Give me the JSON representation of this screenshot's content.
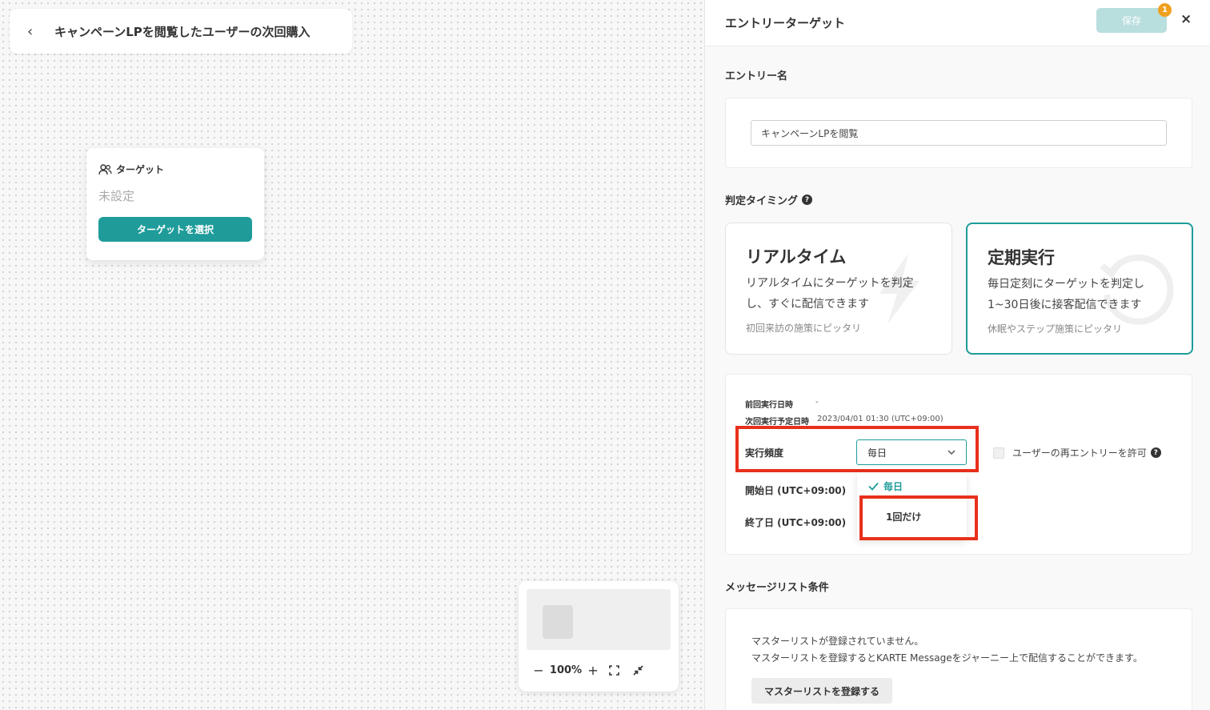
{
  "header": {
    "journey_title": "キャンペーンLPを閲覧したユーザーの次回購入",
    "back_icon": "chevron-left-icon"
  },
  "target_node": {
    "title": "ターゲット",
    "icon": "users-icon",
    "status": "未設定",
    "button_label": "ターゲットを選択"
  },
  "zoom": {
    "minus": "−",
    "value": "100%",
    "plus": "+"
  },
  "panel": {
    "title": "エントリーターゲット",
    "save_label": "保存",
    "save_badge": "1",
    "close_label": "×",
    "entry_name_label": "エントリー名",
    "entry_name_value": "キャンペーンLPを閲覧",
    "timing_label": "判定タイミング",
    "modes": [
      {
        "title": "リアルタイム",
        "desc1": "リアルタイムにターゲットを判定",
        "desc2": "し、すぐに配信できます",
        "note": "初回来訪の施策にピッタリ",
        "selected": false
      },
      {
        "title": "定期実行",
        "desc1": "毎日定刻にターゲットを判定し",
        "desc2": "1~30日後に接客配信できます",
        "note": "休眠やステップ施策にピッタリ",
        "selected": true
      }
    ],
    "schedule": {
      "last_run_label": "前回実行日時",
      "last_run_value": "-",
      "next_run_label": "次回実行予定日時",
      "next_run_value": "2023/04/01 01:30 (UTC+09:00)",
      "frequency_label": "実行頻度",
      "frequency_value": "毎日",
      "frequency_options": [
        "毎日",
        "1回だけ"
      ],
      "start_label": "開始日 (UTC+09:00)",
      "end_label": "終了日 (UTC+09:00)",
      "reentry_label": "ユーザーの再エントリーを許可"
    },
    "message": {
      "label": "メッセージリスト条件",
      "line1": "マスターリストが登録されていません。",
      "line2": "マスターリストを登録するとKARTE Messageをジャーニー上で配信することができます。",
      "button": "マスターリストを登録する"
    }
  },
  "colors": {
    "accent": "#1f9c9a",
    "highlight": "#e8301c",
    "badge": "#f0a020"
  }
}
